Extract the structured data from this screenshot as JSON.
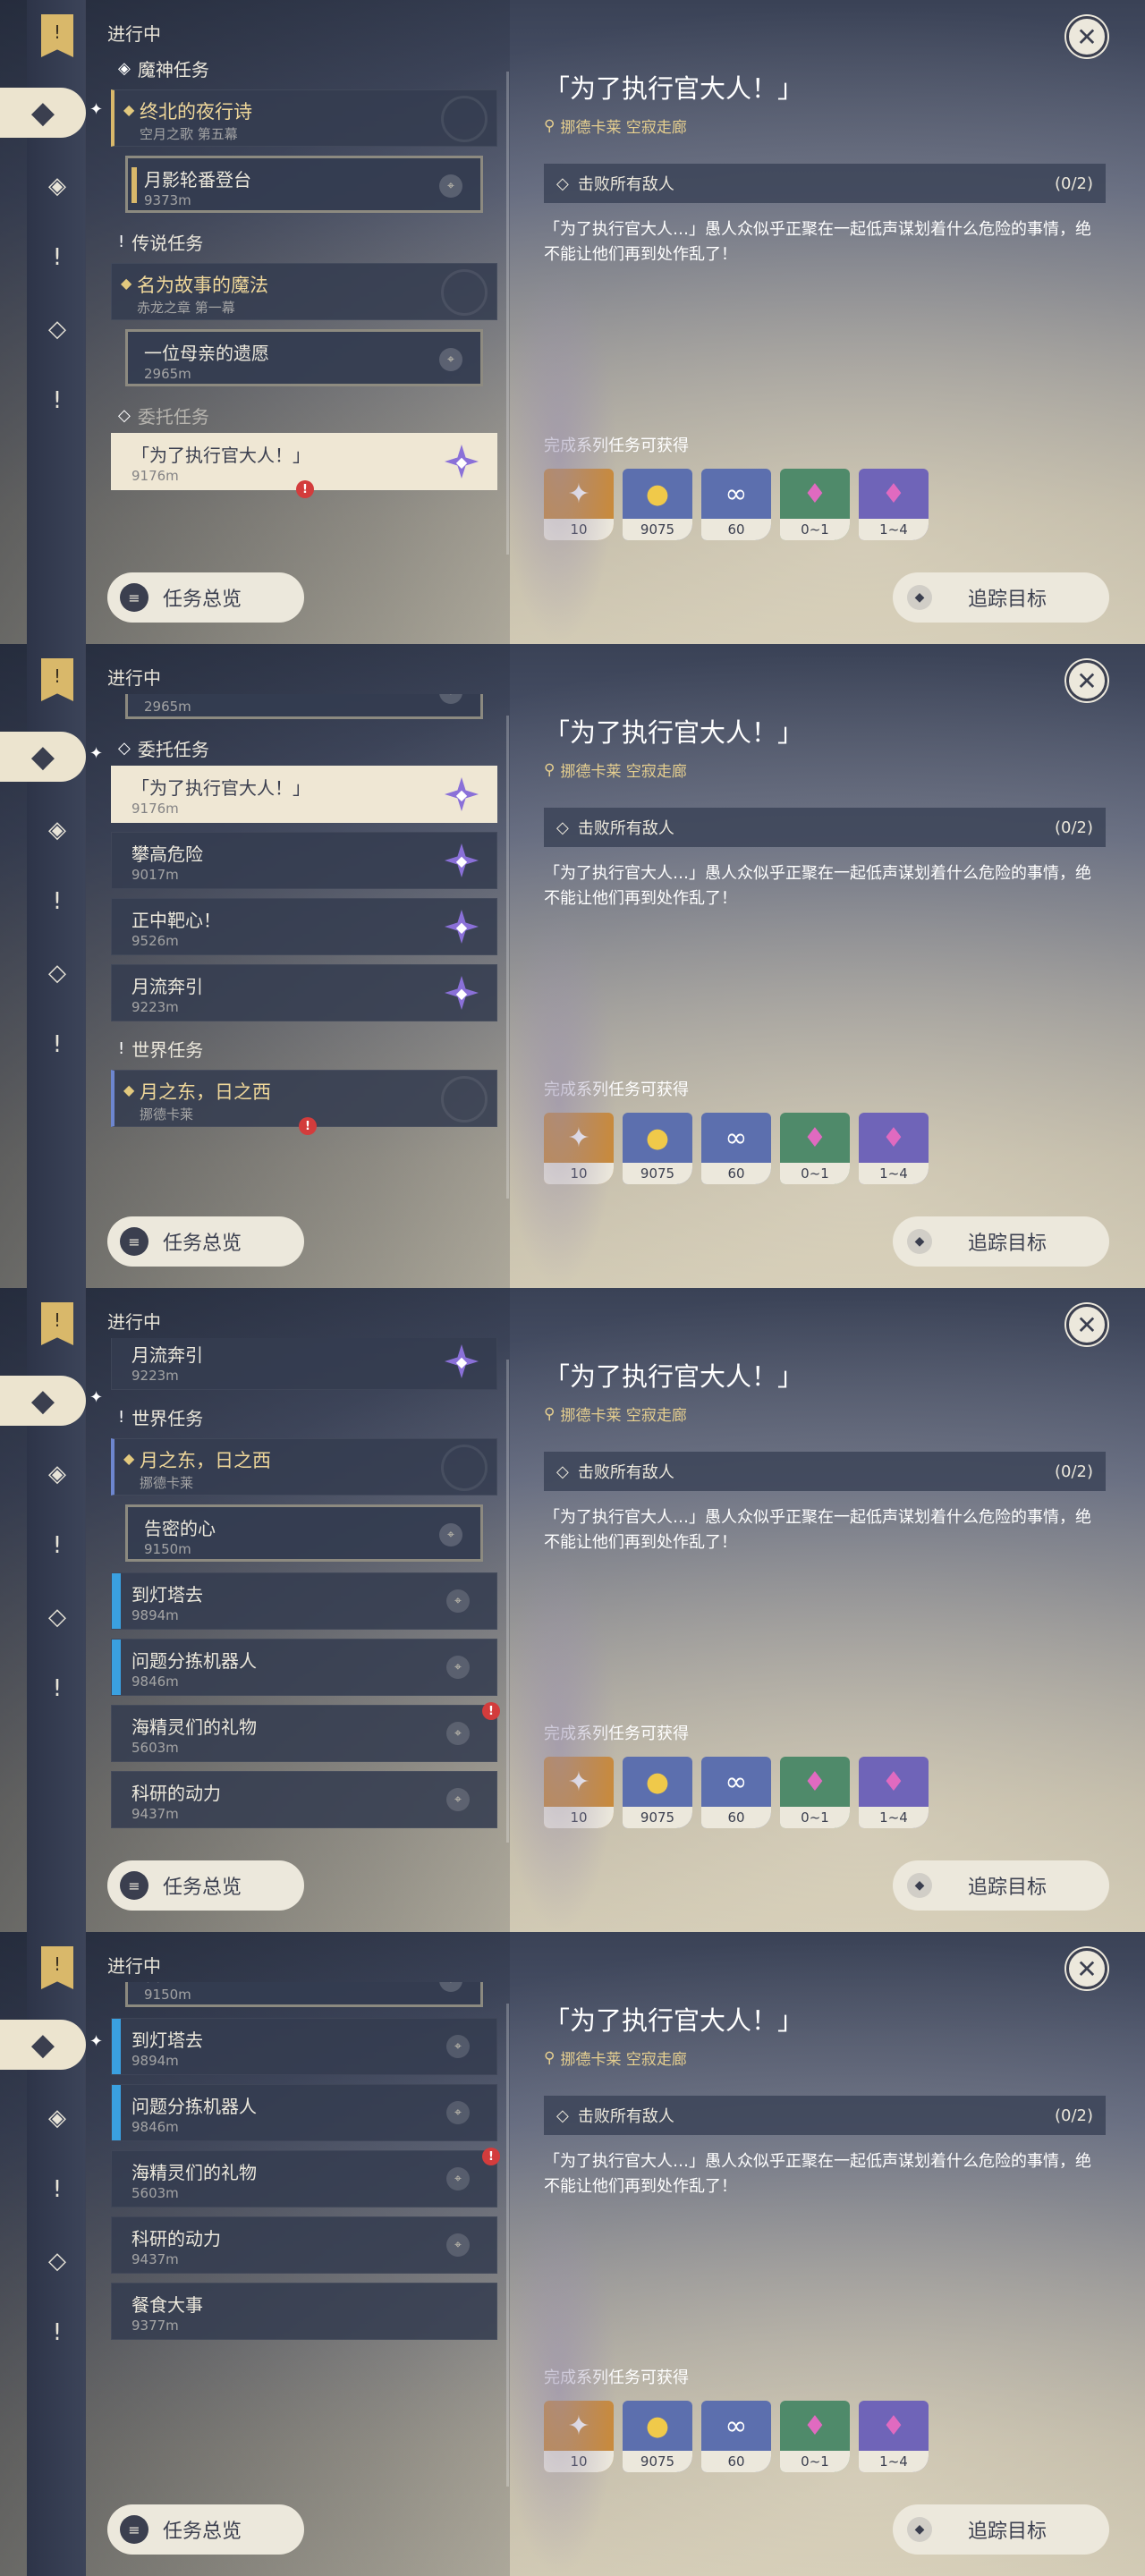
{
  "header": {
    "in_progress": "进行中"
  },
  "categories": {
    "archon": "魔神任务",
    "legend": "传说任务",
    "commission": "委托任务",
    "world": "世界任务"
  },
  "quests": {
    "archon_main": {
      "title": "终北的夜行诗",
      "desc": "空月之歌 第五幕"
    },
    "archon_sub": {
      "title": "月影轮番登台",
      "dist": "9373m"
    },
    "legend_main": {
      "title": "名为故事的魔法",
      "desc": "赤龙之章 第一幕"
    },
    "legend_sub": {
      "title": "一位母亲的遗愿",
      "dist": "2965m"
    },
    "c1": {
      "title": "「为了执行官大人！」",
      "dist": "9176m"
    },
    "c2": {
      "title": "攀高危险",
      "dist": "9017m"
    },
    "c3": {
      "title": "正中靶心！",
      "dist": "9526m"
    },
    "c4": {
      "title": "月流奔引",
      "dist": "9223m"
    },
    "world_main": {
      "title": "月之东，日之西",
      "desc": "挪德卡莱"
    },
    "world_sub": {
      "title": "告密的心",
      "dist": "9150m"
    },
    "w1": {
      "title": "到灯塔去",
      "dist": "9894m"
    },
    "w2": {
      "title": "问题分拣机器人",
      "dist": "9846m"
    },
    "w3": {
      "title": "海精灵们的礼物",
      "dist": "5603m"
    },
    "w4": {
      "title": "科研的动力",
      "dist": "9437m"
    },
    "w5": {
      "title": "餐食大事",
      "dist": "9377m"
    }
  },
  "detail": {
    "title": "「为了执行官大人！」",
    "location": "挪德卡莱 空寂走廊",
    "objective": "击败所有敌人",
    "progress": "(0/2)",
    "description": "「为了执行官大人…」愚人众似乎正聚在一起低声谋划着什么危险的事情，绝不能让他们再到处作乱了！",
    "rewards_label": "完成系列任务可获得",
    "rewards": [
      {
        "name": "star-glitter",
        "count": "10"
      },
      {
        "name": "mora",
        "count": "9075"
      },
      {
        "name": "companionship-exp",
        "count": "60"
      },
      {
        "name": "ore-crystal",
        "count": "0~1"
      },
      {
        "name": "enhancement-crystal",
        "count": "1~4"
      }
    ]
  },
  "buttons": {
    "overview": "任务总览",
    "track": "追踪目标"
  },
  "colors": {
    "accent_gold": "#d9b86a",
    "commission_purple": "#8a70d8",
    "world_blue": "#6d86cf",
    "badge_red": "#d33c3c"
  }
}
